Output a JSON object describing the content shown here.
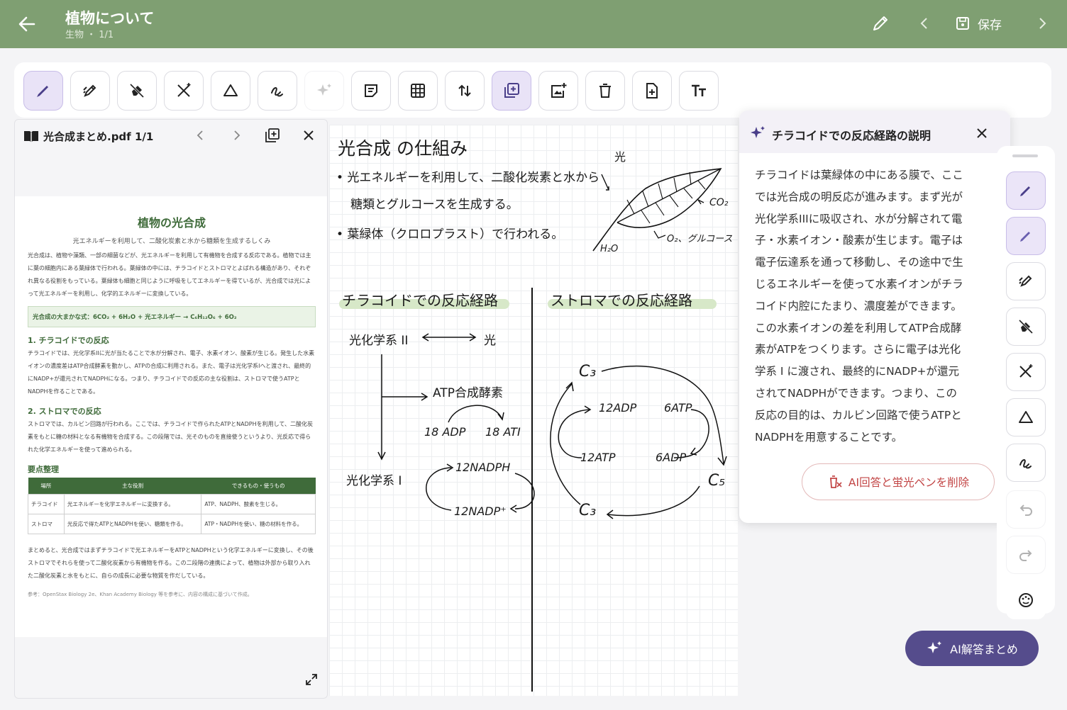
{
  "header": {
    "title": "植物について",
    "subtitle": "生物 ・ 1/1",
    "save_label": "保存"
  },
  "pdf": {
    "filename": "光合成まとめ.pdf",
    "page_count": "1/1",
    "doc": {
      "title": "植物の光合成",
      "subtitle": "光エネルギーを利用して、二酸化炭素と水から糖類を生成するしくみ",
      "intro": "光合成は、植物や藻類、一部の細菌などが、光エネルギーを利用して有機物を合成する反応である。植物では主に葉の細胞内にある葉緑体で行われる。葉緑体の中には、チラコイドとストロマとよばれる構造があり、それぞれ異なる役割をもっている。葉緑体も細胞と同じように呼吸をしてエネルギーを得ているが、光合成では光によって光エネルギーを利用し、化学的エネルギーに変換している。",
      "formula": "光合成の大まかな式：6CO₂ + 6H₂O + 光エネルギー → C₆H₁₂O₆ + 6O₂",
      "s1_title": "1. チラコイドでの反応",
      "s1_text": "チラコイドでは、光化学系IIに光が当たることで水が分解され、電子、水素イオン、酸素が生じる。発生した水素イオンの濃度差はATP合成酵素を動かし、ATPの合成に利用される。また、電子は光化学系Iへと渡され、最終的にNADP+が還元されてNADPHになる。つまり、チラコイドでの反応の主な役割は、ストロマで使うATPとNADPHを作ることである。",
      "s2_title": "2. ストロマでの反応",
      "s2_text": "ストロマでは、カルビン回路が行われる。ここでは、チラコイドで作られたATPとNADPHを利用して、二酸化炭素をもとに糖の材料となる有機物を合成する。この段階では、光そのものを直接使うというより、光反応で得られた化学エネルギーを使って進められる。",
      "summary_title": "要点整理",
      "table_headers": [
        "場所",
        "主な役割",
        "できるもの・使うもの"
      ],
      "table_rows": [
        [
          "チラコイド",
          "光エネルギーを化学エネルギーに変換する。",
          "ATP、NADPH、酸素を生じる。"
        ],
        [
          "ストロマ",
          "光反応で得たATPとNADPHを使い、糖類を作る。",
          "ATP・NADPHを使い、糖の材料を作る。"
        ]
      ],
      "conclusion": "まとめると、光合成ではまずチラコイドで光エネルギーをATPとNADPHという化学エネルギーに変換し、その後ストロマでそれらを使って二酸化炭素から有機物を作る。この二段階の連携によって、植物は外部から取り入れた二酸化炭素と水をもとに、自らの成長に必要な物質を作だしている。",
      "reference": "参考：OpenStax Biology 2e、Khan Academy Biology 等を参考に、内容の構成に基づいて作成。"
    }
  },
  "canvas": {
    "heading": "光合成 の仕組み",
    "bullet1_line1": "• 光エネルギーを利用して、二酸化炭素と水から",
    "bullet1_line2": "糖類とグルコースを生成する。",
    "bullet2": "• 葉緑体（クロロプラスト）で行われる。",
    "leaf_light": "光",
    "leaf_co2": "CO₂",
    "leaf_o2": "O₂、グルコース",
    "leaf_h2o": "H₂O",
    "thylakoid_heading": "チラコイドでの反応経路",
    "stroma_heading": "ストロマでの反応経路",
    "ps2": "光化学系 II",
    "light": "光",
    "atp_synthase": "ATP合成酵素",
    "adp18": "18 ADP",
    "atp18": "18 ATI",
    "ps1": "光化学系 I",
    "nadph12": "12NADPH",
    "nadp12": "12NADP⁺",
    "c3_top": "C₃",
    "c3_bottom": "C₃",
    "c5": "C₅",
    "adp12": "12ADP",
    "atp6": "6ATP",
    "atp12": "12ATP",
    "adp6": "6ADP"
  },
  "ai_panel": {
    "title": "チラコイドでの反応経路の説明",
    "lines": [
      "チラコイドは葉緑体の中にある膜で、ここ",
      "では光合成の明反応が進みます。まず光が",
      "光化学系IIIに吸収され、水が分解されて電",
      "子・水素イオン・酸素が生じます。電子は",
      "電子伝達系を通って移動し、その途中で生",
      "じるエネルギーを使って水素イオンがチラ",
      "コイド内腔にたまり、濃度差ができます。",
      "この水素イオンの差を利用してATP合成酵",
      "素がATPをつくります。さらに電子は光化",
      "学系 I に渡され、最終的にNADP+が還元",
      "されてNADPHができます。つまり、この",
      "反応の目的は、カルビン回路で使うATPと",
      "NADPHを用意することです。"
    ],
    "delete_label": "AI回答と蛍光ペンを削除"
  },
  "summary_button": {
    "label": "AI解答まとめ"
  },
  "colors": {
    "header": "#7f9f72",
    "accent": "#554c8c",
    "active_tool": "#e9e3f7",
    "danger": "#c24545"
  }
}
